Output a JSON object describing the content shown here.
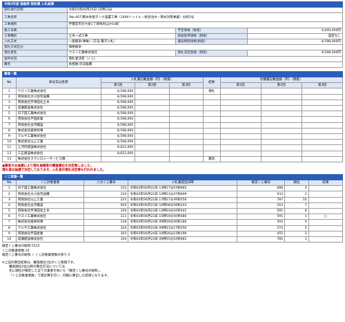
{
  "info": {
    "title": "令和3年度 福島県 契約課 入札結果",
    "rows": [
      {
        "label": "開札執行日時",
        "value": "令和03年06月25日 15時13分"
      },
      {
        "label": "工事名称",
        "value": "[No.407]雨水貯留タンク設置工事（1000リットル・総合治水・雨水対策事業）分割1号"
      },
      {
        "label": "工事場所",
        "value": "宇都宮市元今泉1丁目地内ほか10町"
      }
    ],
    "grid": [
      {
        "l1": "施工日数",
        "v1": "",
        "l2": "予定価格（税抜）",
        "v2": "9,600,000円"
      },
      {
        "l1": "工事種別",
        "v1": "土木一式工事",
        "l2": "調査基準価格（税抜）",
        "v2": "設定なし"
      },
      {
        "l1": "入札方式",
        "v1": "一般競争(事後)（方法:電子入札）",
        "l2": "最低制限価格(税抜)",
        "v2": "8,598,000円"
      },
      {
        "l1": "落札方式区分",
        "v1": "価格競争",
        "l2": "",
        "v2": ""
      }
    ],
    "winner": {
      "label": "落札者名",
      "value": "ウスイ工業株式会社",
      "label2": "落札決定金額（税抜）",
      "value2": "8,598,000円"
    },
    "status": {
      "label": "案件状況",
      "value": "落札者決定（くじ）"
    },
    "remarks": {
      "label": "備考",
      "value": "負担額:司法経費"
    }
  },
  "bidders": {
    "title": "業者一覧",
    "headers": {
      "no": "No",
      "name": "商号又は名称",
      "group1": "入札書記載金額（円）（税抜）",
      "group2": "見積書記載金額（円）（税抜）",
      "result": "結果",
      "r1": "第1回",
      "r2": "第2回",
      "r3": "第3回"
    },
    "rows": [
      {
        "no": "1",
        "name": "ウスイ工業株式会社",
        "amount": "8,598,000",
        "result": "落札"
      },
      {
        "no": "2",
        "name": "有限会社大川住宅設備",
        "amount": "8,598,000",
        "result": ""
      },
      {
        "no": "3",
        "name": "有限会社宇津田化土木",
        "amount": "8,598,000",
        "result": ""
      },
      {
        "no": "4",
        "name": "成瀬建設株式会社",
        "amount": "8,598,000",
        "result": ""
      },
      {
        "no": "5",
        "name": "日下田工業株式会社",
        "amount": "8,598,000",
        "result": ""
      },
      {
        "no": "6",
        "name": "有限会社戸田産業",
        "amount": "8,598,000",
        "result": ""
      },
      {
        "no": "7",
        "name": "有限会社古河鐵設",
        "amount": "8,598,000",
        "result": ""
      },
      {
        "no": "8",
        "name": "株式会社綾栄商事",
        "amount": "8,598,000",
        "result": ""
      },
      {
        "no": "9",
        "name": "マルサ工業株式会社",
        "amount": "8,598,000",
        "result": ""
      },
      {
        "no": "10",
        "name": "株式会社山上工業",
        "amount": "8,598,000",
        "result": ""
      },
      {
        "no": "11",
        "name": "上河内建設株式会社",
        "amount": "8,622,000",
        "result": ""
      },
      {
        "no": "12",
        "name": "三正建設株式会社",
        "amount": "8,622,000",
        "result": ""
      },
      {
        "no": "13",
        "name": "株式会社クラシロジーサービス橋",
        "amount": "",
        "result": "無効"
      }
    ]
  },
  "notice": {
    "line1": "●業者※は抽選により落札候補者の審査順位を決定致しました。",
    "line2": "落札者は抽選で決定しております。入札者の落札決定等も行われました。"
  },
  "lottery": {
    "title": "くじ実施一覧",
    "headers": {
      "no": "No",
      "name": "くじ対象業者",
      "input": "入力くじ番号",
      "time": "入札書提出日時",
      "num": "確定くじ番号",
      "rank": "順位",
      "result": "結果"
    },
    "rows": [
      {
        "no": "1",
        "name": "日下田工業株式会社",
        "input": "123",
        "time": "令和03年06月22日 13時17分53秒965",
        "num": "088",
        "rank": "4",
        "result": ""
      },
      {
        "no": "2",
        "name": "有限会社大川住宅設備",
        "input": "234",
        "time": "令和03年06月22日 14時23分47秒699",
        "num": "933",
        "rank": "2",
        "result": ""
      },
      {
        "no": "3",
        "name": "有限会社山上工業",
        "input": "231",
        "time": "令和03年06月22日 17時27分39秒556",
        "num": "787",
        "rank": "10",
        "result": ""
      },
      {
        "no": "4",
        "name": "有限会社古河鐵設",
        "input": "920",
        "time": "令和03年06月23日 10時08分58秒243",
        "num": "163",
        "rank": "7",
        "result": ""
      },
      {
        "no": "5",
        "name": "有限会社宇津田化土木",
        "input": "250",
        "time": "令和03年06月23日 13時03分16秒341",
        "num": "591",
        "rank": "8",
        "result": ""
      },
      {
        "no": "6",
        "name": "ウスイ工業株式会社",
        "input": "111",
        "time": "令和03年06月23日 15時50分50秒480",
        "num": "591",
        "rank": "1",
        "result": "○"
      },
      {
        "no": "7",
        "name": "株式会社綾栄商事",
        "input": "318",
        "time": "令和03年06月24日 09時39分56秒186",
        "num": "504",
        "rank": "9",
        "result": ""
      },
      {
        "no": "8",
        "name": "マルサ工業株式会社",
        "input": "324",
        "time": "令和03年06月24日 09時31分17秒250",
        "num": "574",
        "rank": "5",
        "result": ""
      },
      {
        "no": "9",
        "name": "有限会社戸田産業",
        "input": "303",
        "time": "令和03年06月24日 10時26分23秒196",
        "num": "455",
        "rank": "3",
        "result": ""
      },
      {
        "no": "10",
        "name": "成瀬建設株式会社",
        "input": "104",
        "time": "令和03年06月24日 09時55分54秒681",
        "num": "785",
        "rank": "3",
        "result": ""
      }
    ]
  },
  "summary": {
    "line1": "確定くじ番号の総和:5515",
    "line2": "くじ対象業者数:10",
    "line3": "確定くじ番号の総和 ÷ くじ対象業者数の余り:5"
  },
  "notes": {
    "line1": "※上記の算出結果は、審査順位1位のくじ情報です。",
    "line2": "審査順位2位以降の算出方法については、",
    "line3": "先に順位が確定した全ての業者を除いた「確定くじ番号の総和」、",
    "line4": "「くじ対象業者数」で再計算を行い、同様に算出した結果となります。"
  }
}
